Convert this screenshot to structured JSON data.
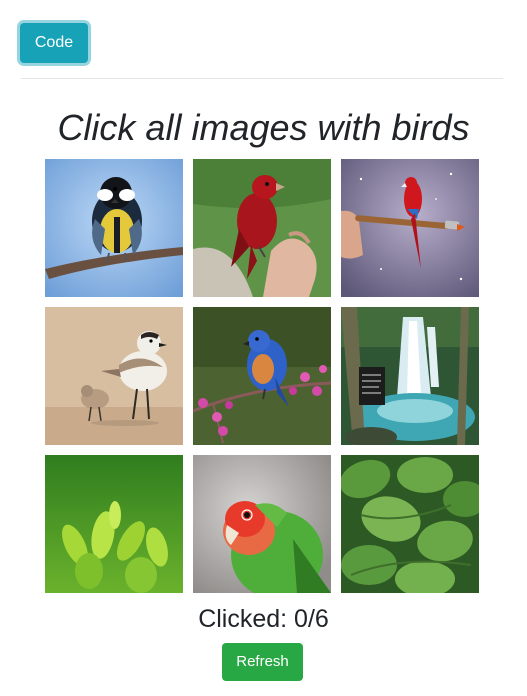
{
  "toolbar": {
    "code_label": "Code"
  },
  "captcha": {
    "title": "Click all images with birds",
    "counter_label": "Clicked: ",
    "clicked": "0",
    "total": "6",
    "counter_text": "Clicked: 0/6",
    "refresh_label": "Refresh",
    "tiles": [
      {
        "subject": "great-tit-on-branch",
        "is_bird": true
      },
      {
        "subject": "red-tanager-on-hand",
        "is_bird": true
      },
      {
        "subject": "red-parrot-on-paintbrush",
        "is_bird": true
      },
      {
        "subject": "plover-with-chick-on-sand",
        "is_bird": true
      },
      {
        "subject": "bluebird-on-blossom-branch",
        "is_bird": true
      },
      {
        "subject": "waterfall-with-sign",
        "is_bird": false
      },
      {
        "subject": "tea-plant-leaves",
        "is_bird": false
      },
      {
        "subject": "lovebird-parrot",
        "is_bird": true
      },
      {
        "subject": "green-leaves",
        "is_bird": false
      }
    ]
  },
  "colors": {
    "code_button": "#17a2b8",
    "refresh_button": "#28a745",
    "text": "#212529",
    "divider": "#e3e5e8"
  }
}
